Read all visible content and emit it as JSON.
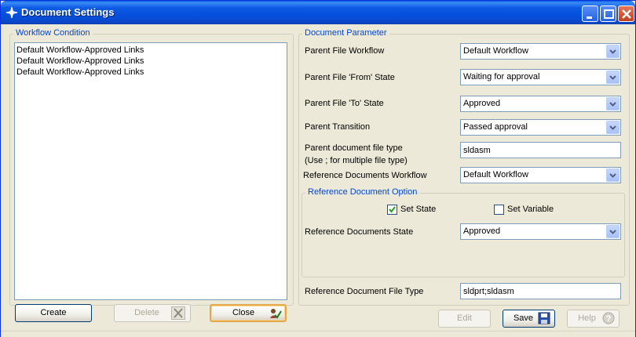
{
  "window": {
    "title": "Document Settings"
  },
  "workflow_condition": {
    "legend": "Workflow Condition",
    "items": [
      "Default Workflow-Approved Links",
      "Default Workflow-Approved Links",
      "Default Workflow-Approved Links"
    ]
  },
  "left_buttons": {
    "create": "Create",
    "delete": "Delete",
    "close": "Close"
  },
  "document_parameter": {
    "legend": "Document Parameter",
    "parent_file_workflow": {
      "label": "Parent File Workflow",
      "value": "Default Workflow"
    },
    "parent_from_state": {
      "label": "Parent File 'From' State",
      "value": "Waiting for approval"
    },
    "parent_to_state": {
      "label": "Parent File 'To' State",
      "value": "Approved"
    },
    "parent_transition": {
      "label": "Parent Transition",
      "value": "Passed approval"
    },
    "parent_doc_type": {
      "label": "Parent document file type",
      "hint": "(Use ; for multiple file type)",
      "value": "sldasm"
    },
    "ref_docs_workflow": {
      "label": "Reference Documents Workflow",
      "value": "Default Workflow"
    }
  },
  "reference_option": {
    "legend": "Reference Document Option",
    "set_state": {
      "label": "Set State",
      "checked": true
    },
    "set_variable": {
      "label": "Set Variable",
      "checked": false
    },
    "ref_docs_state": {
      "label": "Reference Documents State",
      "value": "Approved"
    }
  },
  "ref_file_type": {
    "label": "Reference Document File Type",
    "value": "sldprt;sldasm"
  },
  "right_buttons": {
    "edit": "Edit",
    "save": "Save",
    "help": "Help"
  }
}
